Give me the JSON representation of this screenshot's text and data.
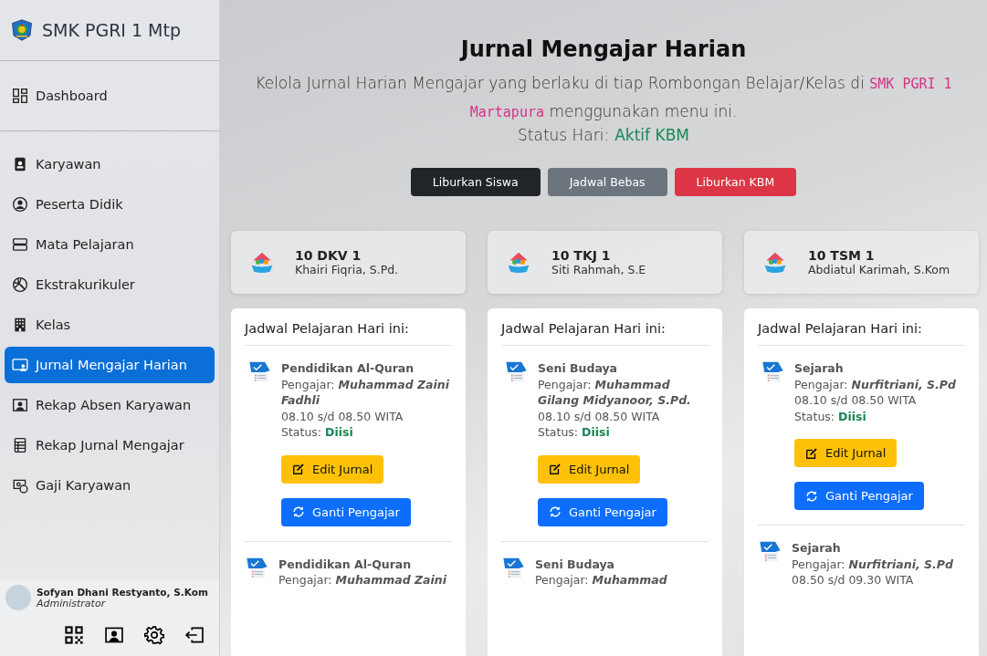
{
  "sidebar": {
    "brand": "SMK PGRI 1 Mtp",
    "top_items": [
      {
        "label": "Dashboard",
        "selected": false
      }
    ],
    "items": [
      {
        "label": "Karyawan",
        "selected": false
      },
      {
        "label": "Peserta Didik",
        "selected": false
      },
      {
        "label": "Mata Pelajaran",
        "selected": false
      },
      {
        "label": "Ekstrakurikuler",
        "selected": false
      },
      {
        "label": "Kelas",
        "selected": false
      },
      {
        "label": "Jurnal Mengajar Harian",
        "selected": true
      },
      {
        "label": "Rekap Absen Karyawan",
        "selected": false
      },
      {
        "label": "Rekap Jurnal Mengajar",
        "selected": false
      },
      {
        "label": "Gaji Karyawan",
        "selected": false
      }
    ],
    "user": {
      "name": "Sofyan Dhani Restyanto, S.Kom",
      "role": "Administrator"
    }
  },
  "header": {
    "title": "Jurnal Mengajar Harian",
    "description": {
      "before": "Kelola Jurnal Harian Mengajar yang berlaku di tiap Rombongan Belajar/Kelas di ",
      "code": "SMK PGRI 1 Martapura",
      "after": " menggunakan menu ini."
    },
    "status_label": "Status Hari:",
    "status_value": "Aktif KBM",
    "buttons": [
      {
        "label": "Liburkan Siswa",
        "kind": "dark"
      },
      {
        "label": "Jadwal Bebas",
        "kind": "secondary"
      },
      {
        "label": "Liburkan KBM",
        "kind": "danger"
      }
    ]
  },
  "classes": [
    {
      "name": "10 DKV 1",
      "homeroom": "Khairi Fiqria, S.Pd.",
      "schedule_title": "Jadwal Pelajaran Hari ini:",
      "entries": [
        {
          "subject": "Pendidikan Al-Quran",
          "teacher_label": "Pengajar:",
          "teacher": "Muhammad Zaini Fadhli",
          "time": "08.10 s/d 08.50 WITA",
          "status_label": "Status:",
          "status": "Diisi",
          "edit": "Edit Jurnal",
          "replace": "Ganti Pengajar"
        },
        {
          "subject": "Pendidikan Al-Quran",
          "teacher_label": "Pengajar:",
          "teacher": "Muhammad Zaini"
        }
      ]
    },
    {
      "name": "10 TKJ 1",
      "homeroom": "Siti Rahmah, S.E",
      "schedule_title": "Jadwal Pelajaran Hari ini:",
      "entries": [
        {
          "subject": "Seni Budaya",
          "teacher_label": "Pengajar:",
          "teacher": "Muhammad Gilang Midyanoor, S.Pd.",
          "time": "08.10 s/d 08.50 WITA",
          "status_label": "Status:",
          "status": "Diisi",
          "edit": "Edit Jurnal",
          "replace": "Ganti Pengajar"
        },
        {
          "subject": "Seni Budaya",
          "teacher_label": "Pengajar:",
          "teacher": "Muhammad"
        }
      ]
    },
    {
      "name": "10 TSM 1",
      "homeroom": "Abdiatul Karimah, S.Kom",
      "schedule_title": "Jadwal Pelajaran Hari ini:",
      "entries": [
        {
          "subject": "Sejarah",
          "teacher_label": "Pengajar:",
          "teacher": "Nurfitriani, S.Pd",
          "time": "08.10 s/d 08.50 WITA",
          "status_label": "Status:",
          "status": "Diisi",
          "edit": "Edit Jurnal",
          "replace": "Ganti Pengajar"
        },
        {
          "subject": "Sejarah",
          "teacher_label": "Pengajar:",
          "teacher": "Nurfitriani, S.Pd",
          "time": "08.50 s/d 09.30 WITA"
        }
      ]
    }
  ]
}
